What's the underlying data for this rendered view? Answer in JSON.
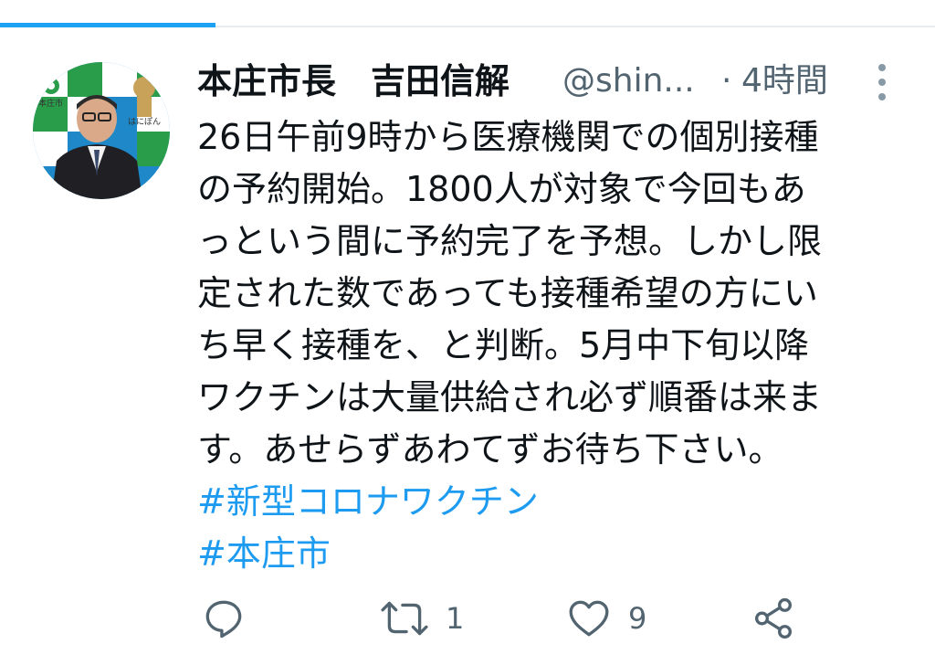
{
  "colors": {
    "accent": "#1da1f2",
    "link": "#1d9bf0",
    "text": "#0f1419",
    "muted": "#536471"
  },
  "load_progress": 0.23,
  "tweet": {
    "author_name": "本庄市長　吉田信解",
    "handle": "@shin...",
    "separator": "·",
    "time": "4時間",
    "lines": [
      "26日午前9時から医療機関での個別接種",
      "の予約開始。1800人が対象で今回もあ",
      "っという間に予約完了を予想。しかし限",
      "定された数であっても接種希望の方にい",
      "ち早く接種を、と判断。5月中下旬以降",
      "ワクチンは大量供給され必ず順番は来ま",
      "す。あせらずあわてずお待ち下さい。"
    ],
    "hashtags": [
      "#新型コロナワクチン",
      "#本庄市"
    ]
  },
  "avatar": {
    "badge_left_text": "本庄市",
    "badge_right_text": "はにぽん"
  },
  "actions": {
    "reply_icon": "reply-icon",
    "retweet_icon": "retweet-icon",
    "retweet_count": "1",
    "like_icon": "heart-icon",
    "like_count": "9",
    "share_icon": "share-icon"
  }
}
